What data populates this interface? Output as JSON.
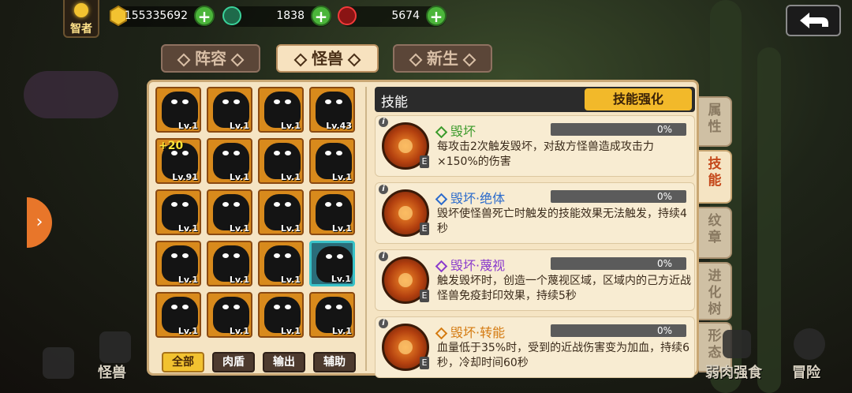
{
  "top": {
    "rank_label": "智者",
    "resources": [
      {
        "icon": "gold-gem-icon",
        "value": "155335692"
      },
      {
        "icon": "green-crystal-icon",
        "value": "1838"
      },
      {
        "icon": "red-crystal-icon",
        "value": "5674"
      }
    ]
  },
  "tabs": [
    "阵容",
    "怪兽",
    "新生"
  ],
  "active_tab": "怪兽",
  "monsters": [
    {
      "lv": "Lv.1"
    },
    {
      "lv": "Lv.1"
    },
    {
      "lv": "Lv.1"
    },
    {
      "lv": "Lv.43"
    },
    {
      "lv": "Lv.91",
      "bonus": "+20"
    },
    {
      "lv": "Lv.1"
    },
    {
      "lv": "Lv.1"
    },
    {
      "lv": "Lv.1"
    },
    {
      "lv": "Lv.1"
    },
    {
      "lv": "Lv.1"
    },
    {
      "lv": "Lv.1"
    },
    {
      "lv": "Lv.1"
    },
    {
      "lv": "Lv.1"
    },
    {
      "lv": "Lv.1"
    },
    {
      "lv": "Lv.1"
    },
    {
      "lv": "Lv.1",
      "selected": true
    },
    {
      "lv": "Lv.1"
    },
    {
      "lv": "Lv.1"
    },
    {
      "lv": "Lv.1"
    },
    {
      "lv": "Lv.1"
    }
  ],
  "filters": [
    "全部",
    "肉盾",
    "输出",
    "辅助"
  ],
  "active_filter": "全部",
  "skills_header": {
    "title": "技能",
    "enhance_label": "技能强化"
  },
  "skills": [
    {
      "name": "毁坏",
      "color": "#3a9a2a",
      "progress": "0%",
      "desc": "每攻击2次触发毁坏，对敌方怪兽造成攻击力×150%的伤害",
      "lv": "E"
    },
    {
      "name": "毁坏·绝体",
      "color": "#2a6acc",
      "progress": "0%",
      "desc": "毁坏使怪兽死亡时触发的技能效果无法触发，持续4秒",
      "lv": "E"
    },
    {
      "name": "毁坏·蔑视",
      "color": "#8a3acc",
      "progress": "0%",
      "desc": "触发毁坏时，创造一个蔑视区域，区域内的己方近战怪兽免疫封印效果，持续5秒",
      "lv": "E"
    },
    {
      "name": "毁坏·转能",
      "color": "#d47a10",
      "progress": "0%",
      "desc": "血量低于35%时，受到的近战伤害变为加血，持续6秒，冷却时间60秒",
      "lv": "E"
    }
  ],
  "side_tabs": [
    "属性",
    "技能",
    "纹章",
    "进化树",
    "形态"
  ],
  "active_side": "技能",
  "bottom_nav": {
    "monster": "怪兽",
    "feast": "弱肉强食",
    "adventure": "冒险"
  }
}
